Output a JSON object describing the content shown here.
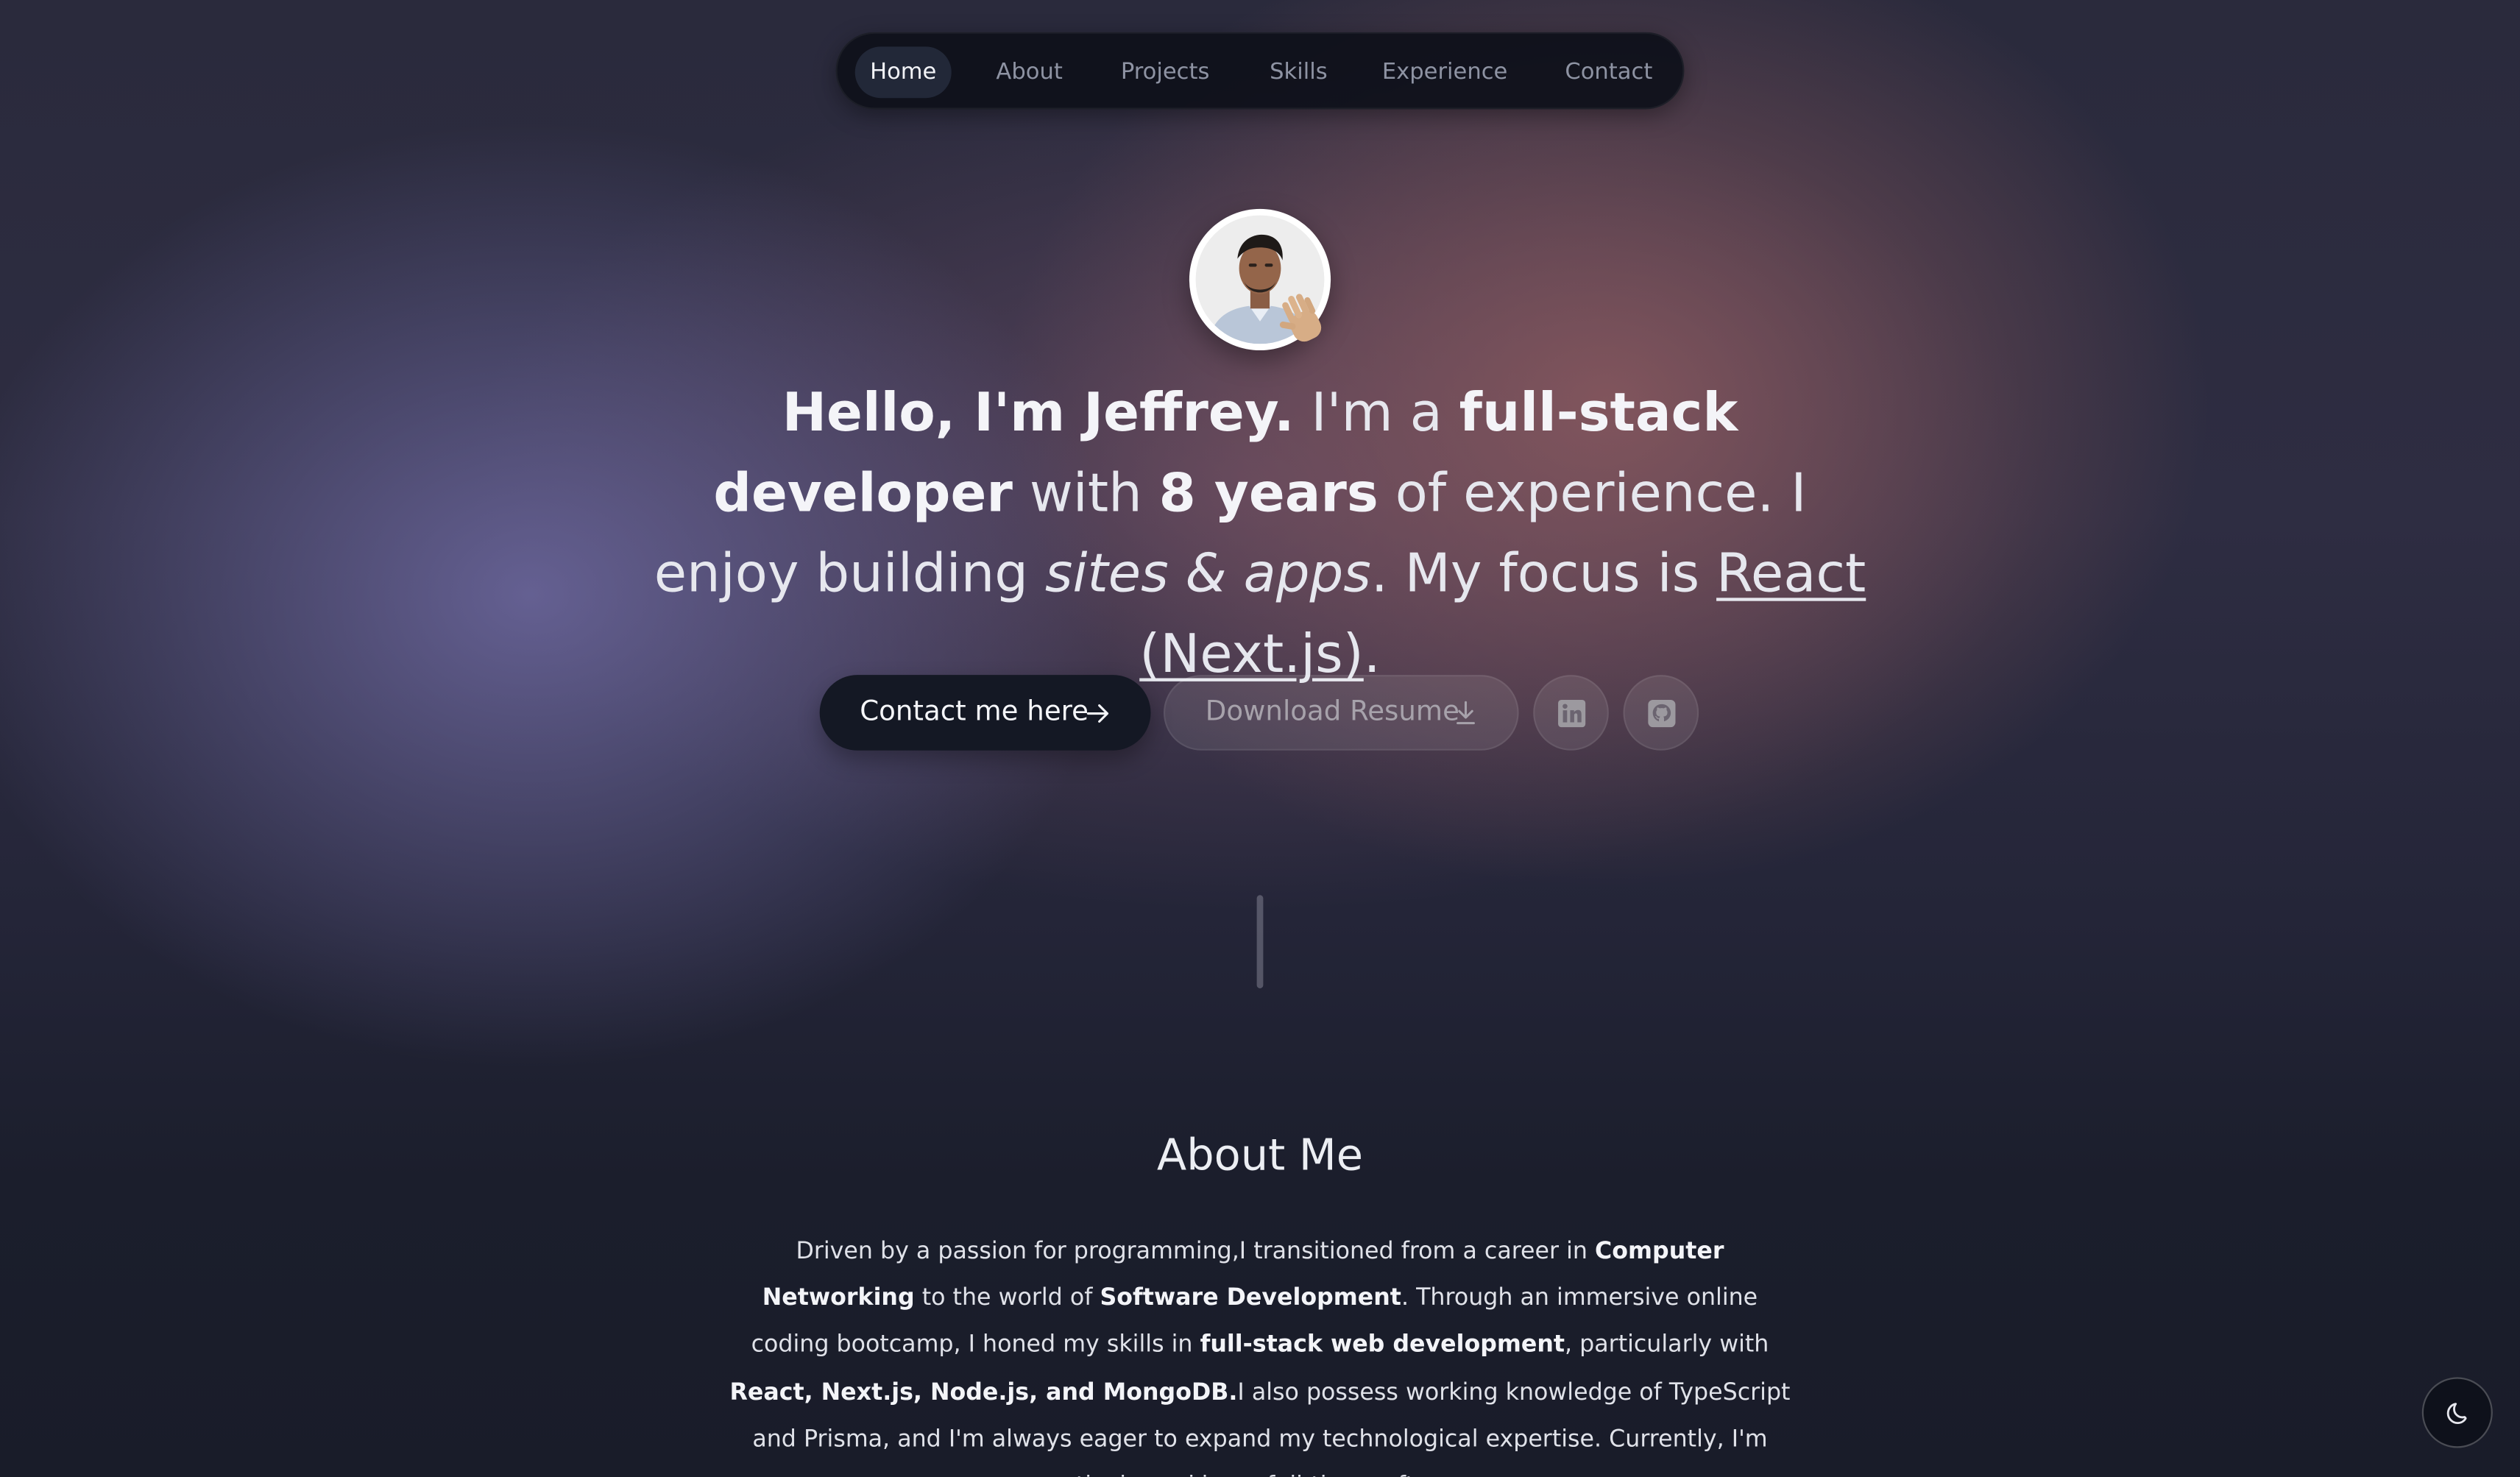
{
  "nav": {
    "items": [
      {
        "label": "Home",
        "active": true
      },
      {
        "label": "About"
      },
      {
        "label": "Projects"
      },
      {
        "label": "Skills"
      },
      {
        "label": "Experience"
      },
      {
        "label": "Contact"
      }
    ]
  },
  "hero": {
    "greeting": "Hello, I'm Jeffrey.",
    "im_a": " I'm a ",
    "role": "full-stack developer",
    "with": " with ",
    "years": "8 years",
    "experience_text": " of experience. I enjoy building ",
    "things": "sites & apps",
    "focus_text": ". My focus is ",
    "focus": "React (Next.js)",
    "end": "."
  },
  "buttons": {
    "contact_label": "Contact me here",
    "contact_icon": "arrow-right-icon",
    "resume_label": "Download Resume",
    "resume_icon": "download-icon",
    "linkedin_icon": "linkedin-icon",
    "github_icon": "github-icon"
  },
  "about": {
    "title": "About Me",
    "p1": "Driven by a passion for programming,I transitioned from a career in ",
    "b1": "Computer Networking",
    "p2": " to the world of ",
    "b2": "Software Development",
    "p3": ". Through an immersive online coding bootcamp, I honed my skills in ",
    "b3": "full-stack web development",
    "p4": ", particularly with ",
    "b4": "React, Next.js, Node.js, and MongoDB.",
    "p5": "I also possess working knowledge of TypeScript and Prisma, and I'm always eager to expand my technological expertise. Currently, I'm actively seeking a full-time software"
  },
  "theme_toggle": {
    "icon": "moon-icon"
  },
  "colors": {
    "accent_dark": "#141824",
    "nav_bg": "#0e101a",
    "text": "#e8e9ee"
  }
}
